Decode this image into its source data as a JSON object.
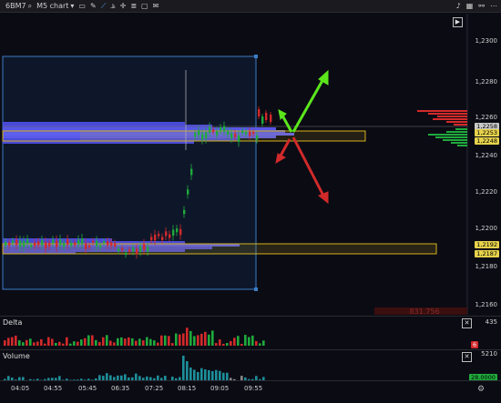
{
  "toolbar": {
    "symbol": "6BM7",
    "chart_type": "M5 chart",
    "chart_type_caret": "▾"
  },
  "main_chart": {
    "price_labels": [
      "1,2300",
      "1,2280",
      "1,2260",
      "1,2240",
      "1,2220",
      "1,2200",
      "1,2180",
      "1,2160"
    ],
    "price_tags": [
      {
        "text": "1,2258",
        "color": "#c8c8c8"
      },
      {
        "text": "1,2253",
        "color": "#e6d24c"
      },
      {
        "text": "1,2248",
        "color": "#e6d24c"
      },
      {
        "text": "1,2192",
        "color": "#e6d24c"
      },
      {
        "text": "1,2187",
        "color": "#e6d24c"
      }
    ],
    "volume_readout": "831.756",
    "up_color": "#1faa3c",
    "down_color": "#d22a2a",
    "box_color": "#3b7dc4",
    "level_color": "#d4b21c",
    "profile_color": "#4a4ad8"
  },
  "delta_pane": {
    "title": "Delta",
    "axis_label": "435",
    "badge": "6"
  },
  "volume_pane": {
    "title": "Volume",
    "axis_label": "5210",
    "badge": "28.0000"
  },
  "time_axis": [
    "04:05",
    "04:55",
    "05:45",
    "06:35",
    "07:25",
    "08:15",
    "09:05",
    "09:55"
  ]
}
